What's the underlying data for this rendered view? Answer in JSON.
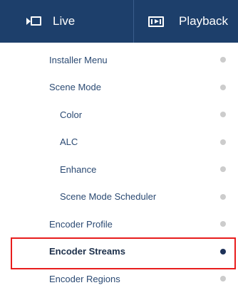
{
  "nav": {
    "tabs": [
      {
        "label": "Live",
        "icon": "live-camera-icon"
      },
      {
        "label": "Playback",
        "icon": "playback-icon"
      }
    ]
  },
  "menu": {
    "items": [
      {
        "label": "Installer Menu",
        "level": 0,
        "active": false
      },
      {
        "label": "Scene Mode",
        "level": 0,
        "active": false
      },
      {
        "label": "Color",
        "level": 1,
        "active": false
      },
      {
        "label": "ALC",
        "level": 1,
        "active": false
      },
      {
        "label": "Enhance",
        "level": 1,
        "active": false
      },
      {
        "label": "Scene Mode Scheduler",
        "level": 1,
        "active": false
      },
      {
        "label": "Encoder Profile",
        "level": 0,
        "active": false
      },
      {
        "label": "Encoder Streams",
        "level": 0,
        "active": true
      },
      {
        "label": "Encoder Regions",
        "level": 0,
        "active": false
      }
    ]
  },
  "colors": {
    "nav_background": "#1d3f6b",
    "menu_text": "#2b4a73",
    "active_dot": "#1d3158",
    "inactive_dot": "#cccccc",
    "highlight": "#e81d1d"
  }
}
